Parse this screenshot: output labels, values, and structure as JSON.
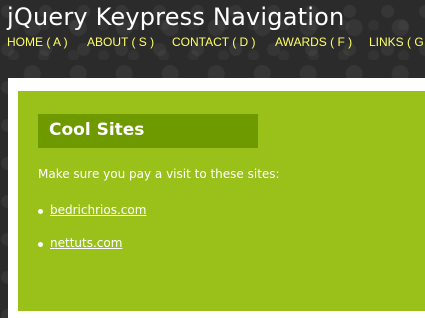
{
  "header": {
    "title": "jQuery Keypress Navigation"
  },
  "nav": {
    "items": [
      {
        "label": "HOME ( A )"
      },
      {
        "label": "ABOUT ( S )"
      },
      {
        "label": "CONTACT ( D )"
      },
      {
        "label": "AWARDS ( F )"
      },
      {
        "label": "LINKS ( G"
      }
    ]
  },
  "main": {
    "heading": "Cool Sites",
    "intro": "Make sure you pay a visit to these sites:",
    "links": [
      {
        "label": "bedrichrios.com"
      },
      {
        "label": "nettuts.com"
      }
    ]
  },
  "colors": {
    "background": "#2b2b2b",
    "nav_text": "#ffff66",
    "content_bg": "#99c11a",
    "heading_bg": "#6e9a00",
    "text": "#ffffff"
  }
}
